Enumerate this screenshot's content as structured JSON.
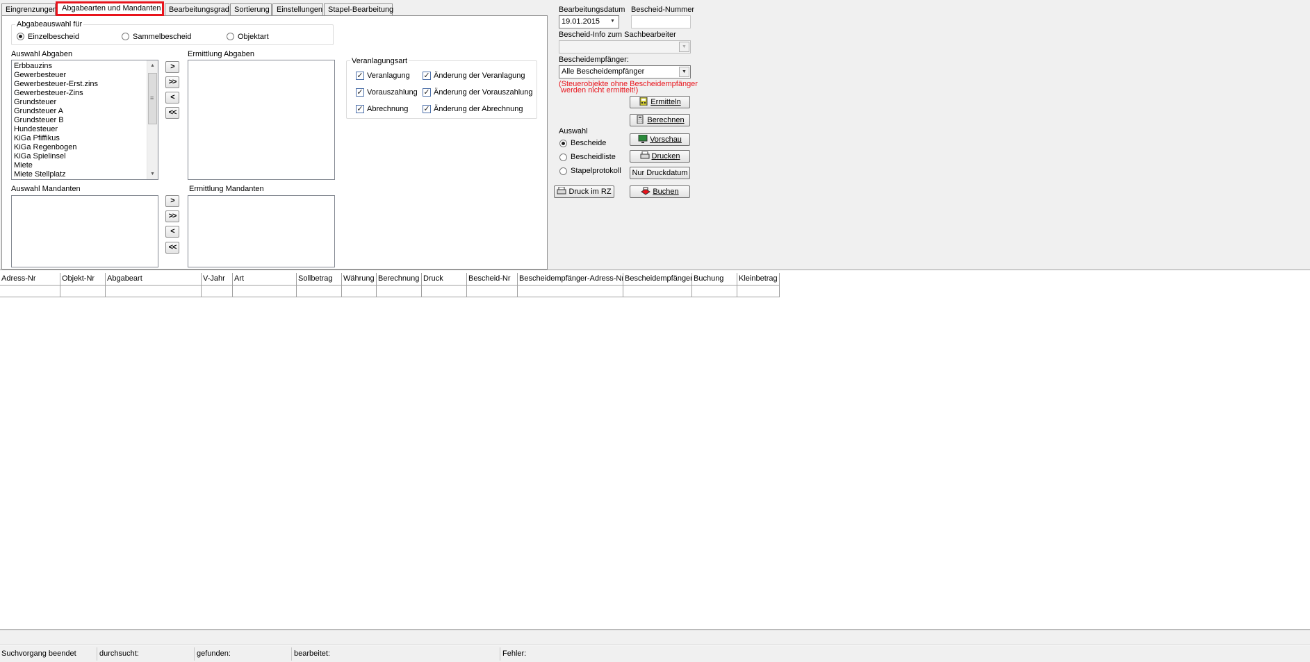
{
  "tabs": [
    "Eingrenzungen",
    "Abgabearten und Mandanten",
    "Bearbeitungsgrad",
    "Sortierung",
    "Einstellungen",
    "Stapel-Bearbeitung"
  ],
  "abgabeauswahl": {
    "legend": "Abgabeauswahl für",
    "options": [
      "Einzelbescheid",
      "Sammelbescheid",
      "Objektart"
    ],
    "selected": "Einzelbescheid"
  },
  "auswahl_abgaben": {
    "label": "Auswahl Abgaben",
    "items": [
      "Erbbauzins",
      "Gewerbesteuer",
      "Gewerbesteuer-Erst.zins",
      "Gewerbesteuer-Zins",
      "Grundsteuer",
      "Grundsteuer A",
      "Grundsteuer B",
      "Hundesteuer",
      "KiGa Pfiffikus",
      "KiGa Regenbogen",
      "KiGa Spielinsel",
      "Miete",
      "Miete Stellplatz"
    ]
  },
  "ermittlung_abgaben": {
    "label": "Ermittlung Abgaben"
  },
  "auswahl_mandanten": {
    "label": "Auswahl Mandanten"
  },
  "ermittlung_mandanten": {
    "label": "Ermittlung Mandanten"
  },
  "move_buttons": [
    ">",
    ">>",
    "<",
    "<<"
  ],
  "veranlagungsart": {
    "legend": "Veranlagungsart",
    "checks": [
      "Veranlagung",
      "Änderung der Veranlagung",
      "Vorauszahlung",
      "Änderung der Vorauszahlung",
      "Abrechnung",
      "Änderung der Abrechnung"
    ],
    "all_checked": true
  },
  "right_panel": {
    "bearbeitungsdatum_label": "Bearbeitungsdatum",
    "bearbeitungsdatum_value": "19.01.2015",
    "bescheid_nummer_label": "Bescheid-Nummer",
    "bescheid_info_label": "Bescheid-Info zum Sachbearbeiter",
    "bescheidempfaenger_label": "Bescheidempfänger:",
    "bescheidempfaenger_value": "Alle Bescheidempfänger",
    "warning_line1": "(Steuerobjekte ohne Bescheidempfänger",
    "warning_line2": " werden nicht ermittelt!)",
    "warning_color": "#e8141c",
    "auswahl_label": "Auswahl",
    "auswahl_options": [
      "Bescheide",
      "Bescheidliste",
      "Stapelprotokoll"
    ],
    "auswahl_selected": "Bescheide",
    "buttons": {
      "ermitteln": "Ermitteln",
      "berechnen": "Berechnen",
      "vorschau": "Vorschau",
      "drucken": "Drucken",
      "nur_druckdatum": "Nur Druckdatum",
      "druck_im_rz": "Druck im RZ",
      "buchen": "Buchen"
    }
  },
  "table": {
    "columns": [
      "Adress-Nr",
      "Objekt-Nr",
      "Abgabeart",
      "V-Jahr",
      "Art",
      "Sollbetrag",
      "Währung",
      "Berechnung",
      "Druck",
      "Bescheid-Nr",
      "Bescheidempfänger-Adress-Nr.",
      "Bescheidempfänger",
      "Buchung",
      "Kleinbetrag"
    ],
    "rows": [
      [
        "",
        "",
        "",
        "",
        "",
        "",
        "",
        "",
        "",
        "",
        "",
        "",
        "",
        ""
      ]
    ]
  },
  "status": {
    "suchvorgang": "Suchvorgang beendet",
    "durchsucht": "durchsucht:",
    "gefunden": "gefunden:",
    "bearbeitet": "bearbeitet:",
    "fehler": "Fehler:"
  }
}
